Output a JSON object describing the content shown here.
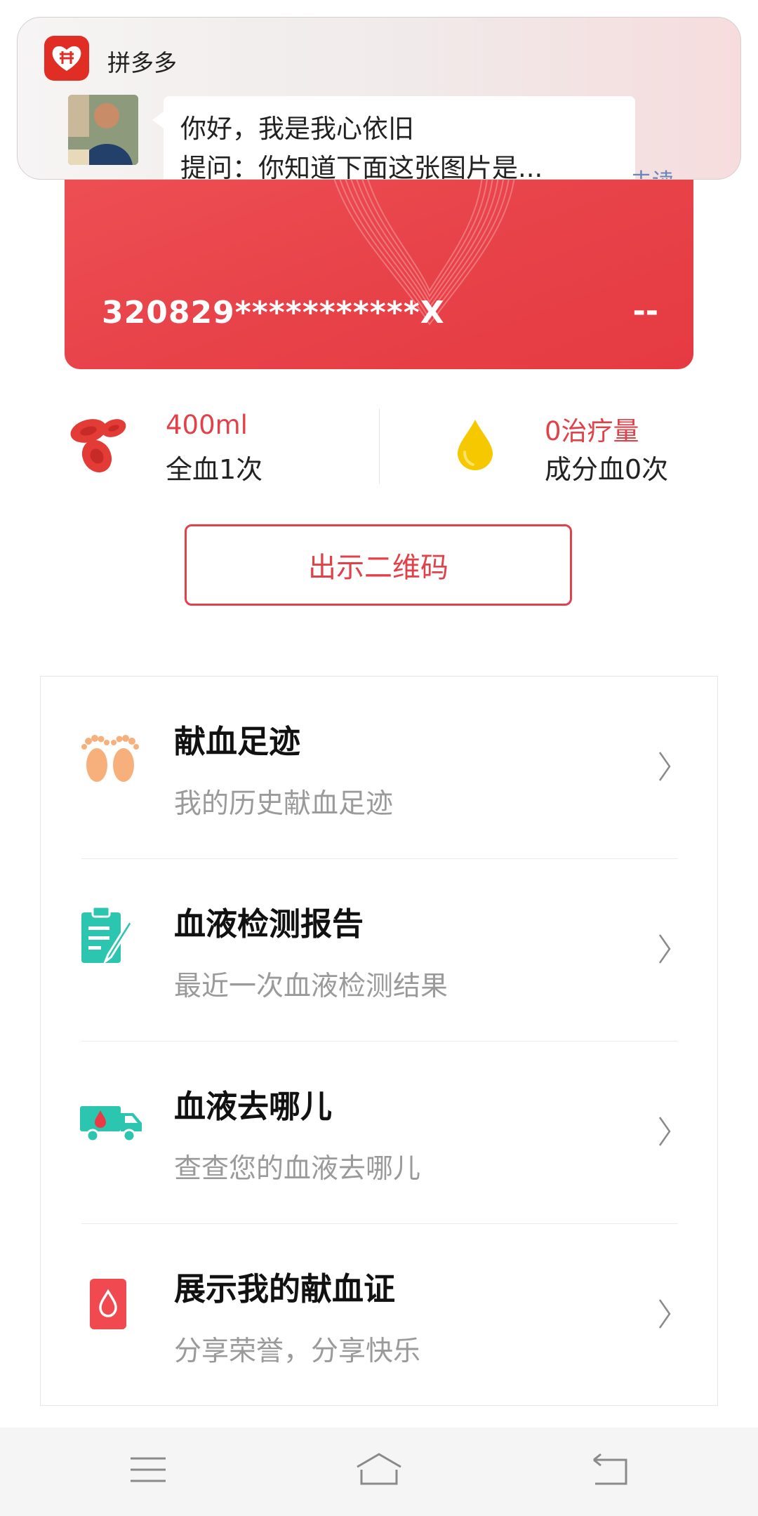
{
  "notification": {
    "app_name": "拼多多",
    "message_line1": "你好，我是我心依旧",
    "message_line2": "提问：你知道下面这张图片是...",
    "unread_label": "未读"
  },
  "card": {
    "id_number": "320829***********X",
    "level": "--"
  },
  "stats": {
    "whole_blood": {
      "amount": "400ml",
      "count": "全血1次"
    },
    "component_blood": {
      "amount": "0治疗量",
      "count": "成分血0次"
    }
  },
  "qr_button_label": "出示二维码",
  "menu": {
    "items": [
      {
        "title": "献血足迹",
        "subtitle": "我的历史献血足迹",
        "icon": "footprints-icon"
      },
      {
        "title": "血液检测报告",
        "subtitle": "最近一次血液检测结果",
        "icon": "clipboard-report-icon"
      },
      {
        "title": "血液去哪儿",
        "subtitle": "查查您的血液去哪儿",
        "icon": "blood-truck-icon"
      },
      {
        "title": "展示我的献血证",
        "subtitle": "分享荣誉，分享快乐",
        "icon": "blood-certificate-icon"
      }
    ]
  },
  "colors": {
    "accent_red": "#e2414a",
    "card_red": "#e8434a",
    "teal": "#2bc5b0",
    "footprint_orange": "#f7b07c",
    "drop_yellow": "#f5c800"
  }
}
